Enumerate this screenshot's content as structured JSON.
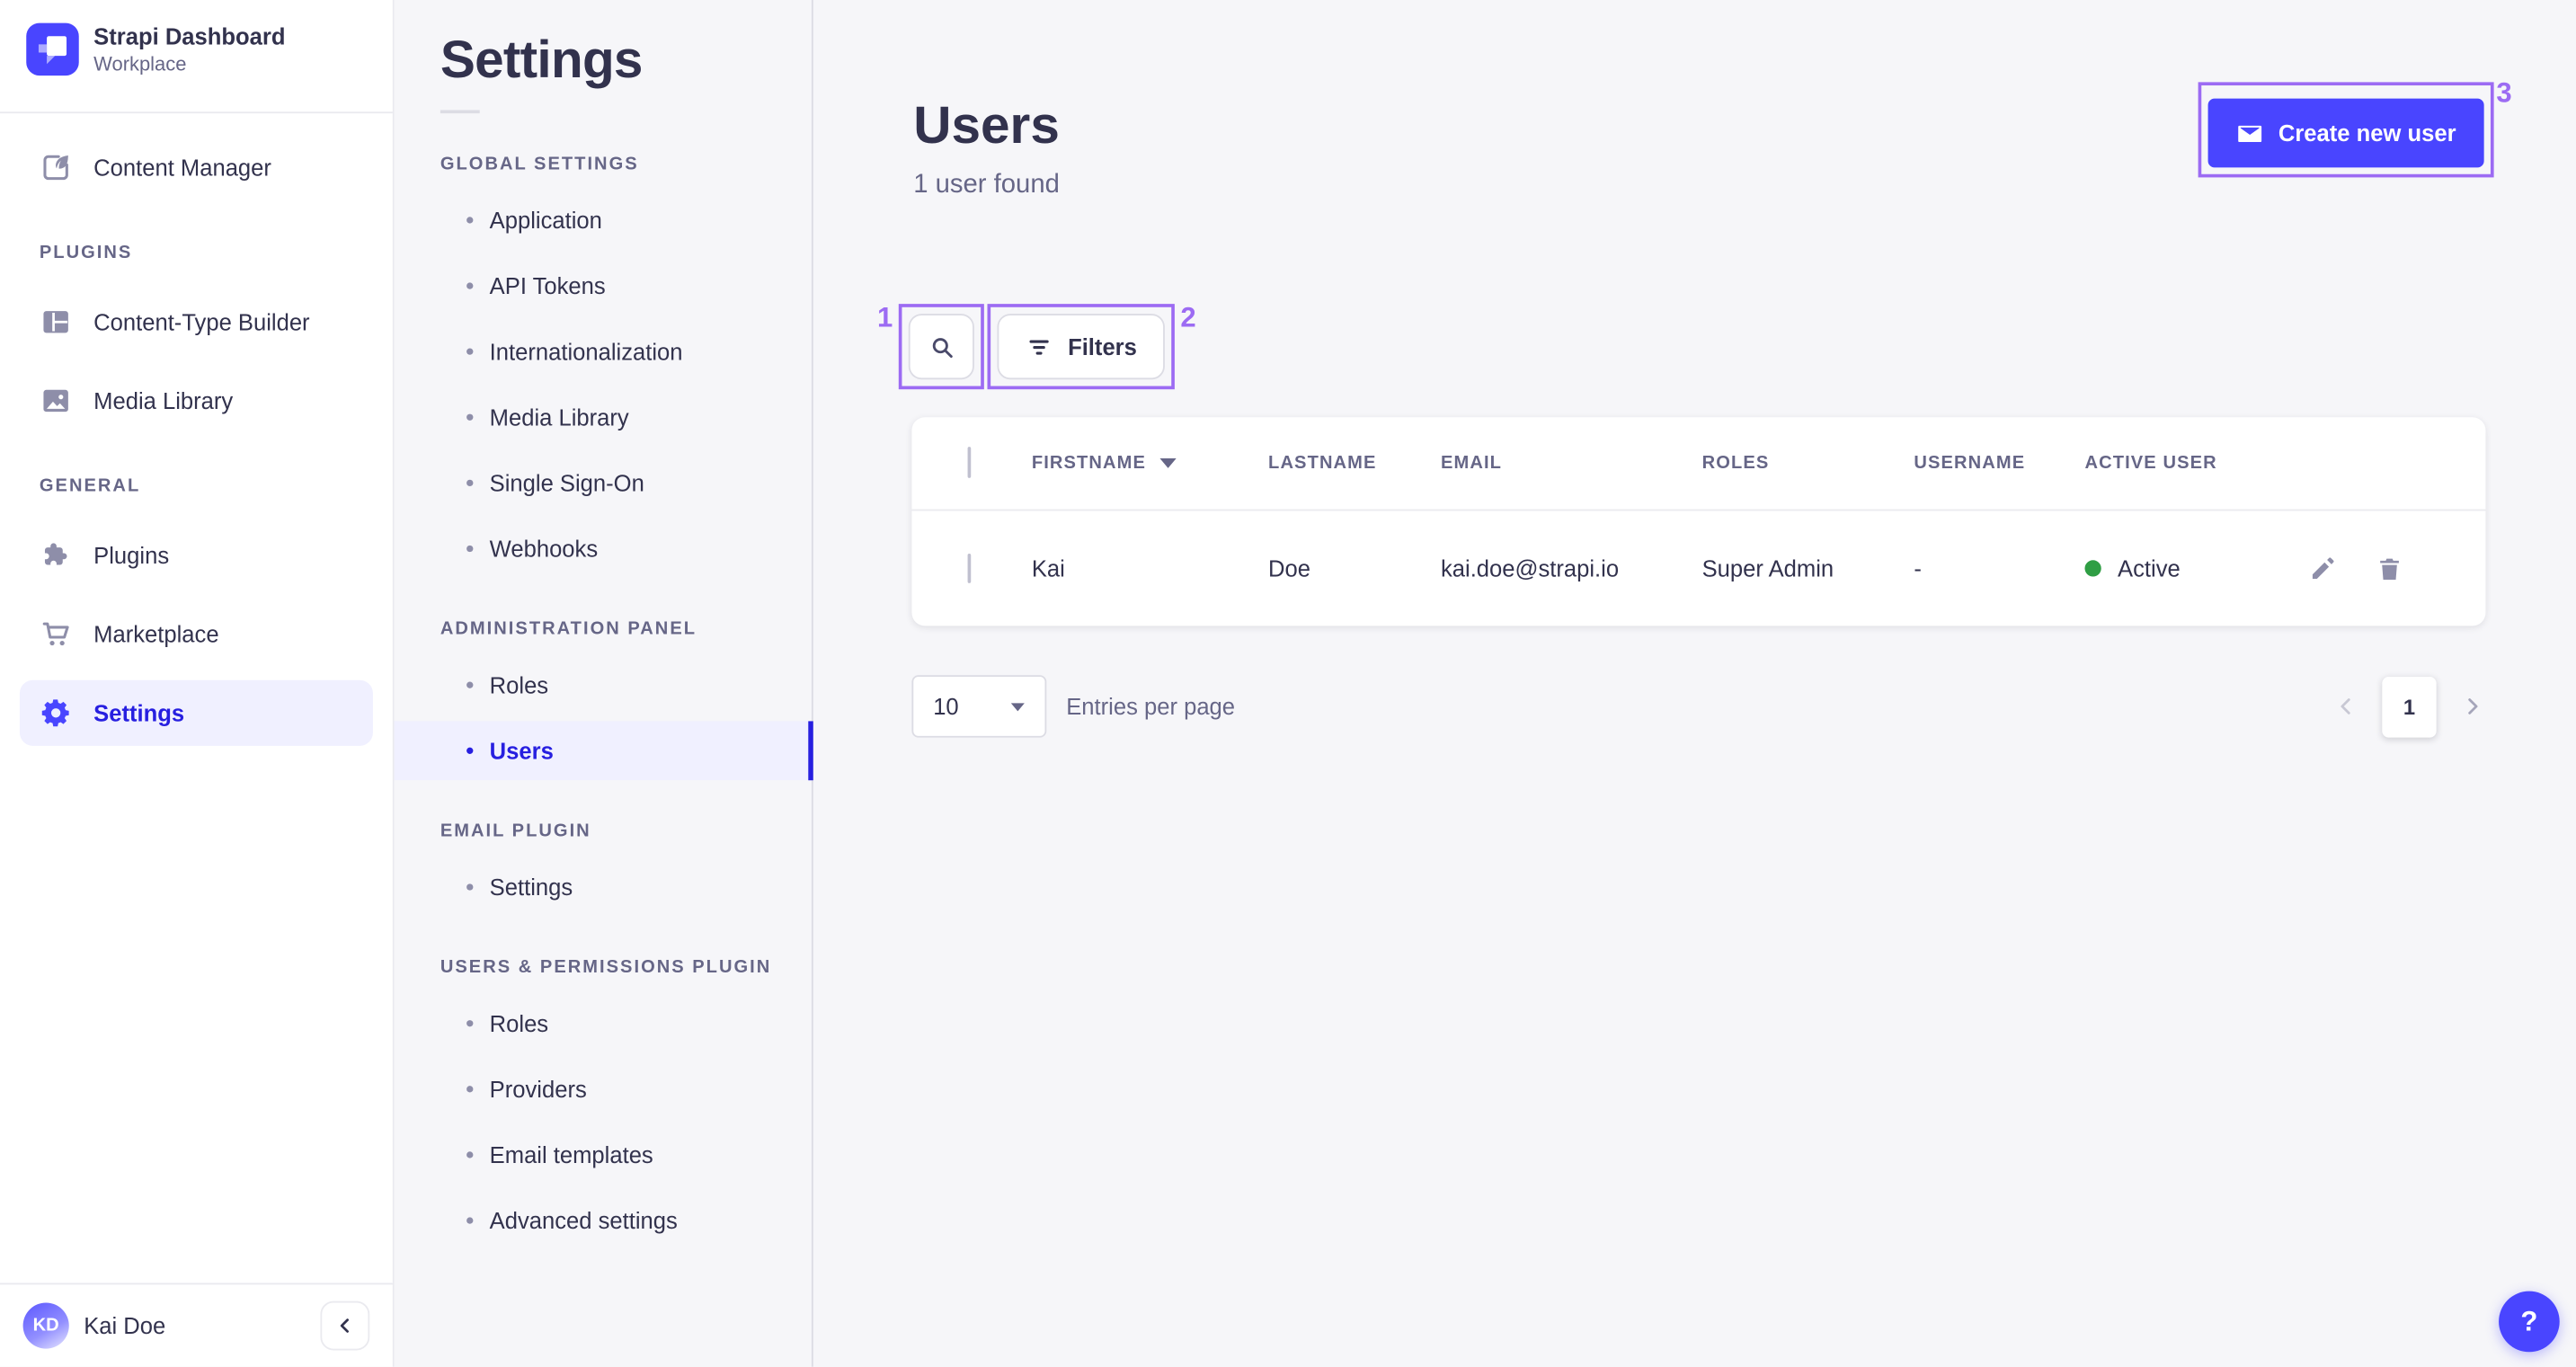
{
  "brand": {
    "title": "Strapi Dashboard",
    "subtitle": "Workplace"
  },
  "sidebar": {
    "primary": [
      {
        "label": "Content Manager"
      }
    ],
    "sections": [
      {
        "label": "PLUGINS",
        "items": [
          {
            "label": "Content-Type Builder"
          },
          {
            "label": "Media Library"
          }
        ]
      },
      {
        "label": "GENERAL",
        "items": [
          {
            "label": "Plugins"
          },
          {
            "label": "Marketplace"
          },
          {
            "label": "Settings",
            "active": true
          }
        ]
      }
    ],
    "footer": {
      "initials": "KD",
      "name": "Kai Doe"
    }
  },
  "subnav": {
    "title": "Settings",
    "sections": [
      {
        "label": "GLOBAL SETTINGS",
        "items": [
          {
            "label": "Application"
          },
          {
            "label": "API Tokens"
          },
          {
            "label": "Internationalization"
          },
          {
            "label": "Media Library"
          },
          {
            "label": "Single Sign-On"
          },
          {
            "label": "Webhooks"
          }
        ]
      },
      {
        "label": "ADMINISTRATION PANEL",
        "items": [
          {
            "label": "Roles"
          },
          {
            "label": "Users",
            "active": true
          }
        ]
      },
      {
        "label": "EMAIL PLUGIN",
        "items": [
          {
            "label": "Settings"
          }
        ]
      },
      {
        "label": "USERS & PERMISSIONS PLUGIN",
        "items": [
          {
            "label": "Roles"
          },
          {
            "label": "Providers"
          },
          {
            "label": "Email templates"
          },
          {
            "label": "Advanced settings"
          }
        ]
      }
    ]
  },
  "main": {
    "title": "Users",
    "subtitle": "1 user found",
    "create_button_label": "Create new user",
    "filters_label": "Filters",
    "table": {
      "headers": {
        "firstname": "FIRSTNAME",
        "lastname": "LASTNAME",
        "email": "EMAIL",
        "roles": "ROLES",
        "username": "USERNAME",
        "active_user": "ACTIVE USER"
      },
      "rows": [
        {
          "firstname": "Kai",
          "lastname": "Doe",
          "email": "kai.doe@strapi.io",
          "roles": "Super Admin",
          "username": "-",
          "status": "Active"
        }
      ]
    },
    "pagination": {
      "page_size": "10",
      "entries_label": "Entries per page",
      "current_page": "1"
    },
    "help_label": "?"
  },
  "annotations": {
    "box1": "1",
    "box2": "2",
    "box3": "3"
  },
  "colors": {
    "primary": "#4945ff",
    "primary_text": "#271fe0",
    "annotation": "#9c6bf3",
    "success_dot": "#2f9e44",
    "background": "#f6f6f9",
    "surface": "#ffffff",
    "text_dark": "#32324d",
    "text_muted": "#666687",
    "border": "#dcdce4"
  }
}
